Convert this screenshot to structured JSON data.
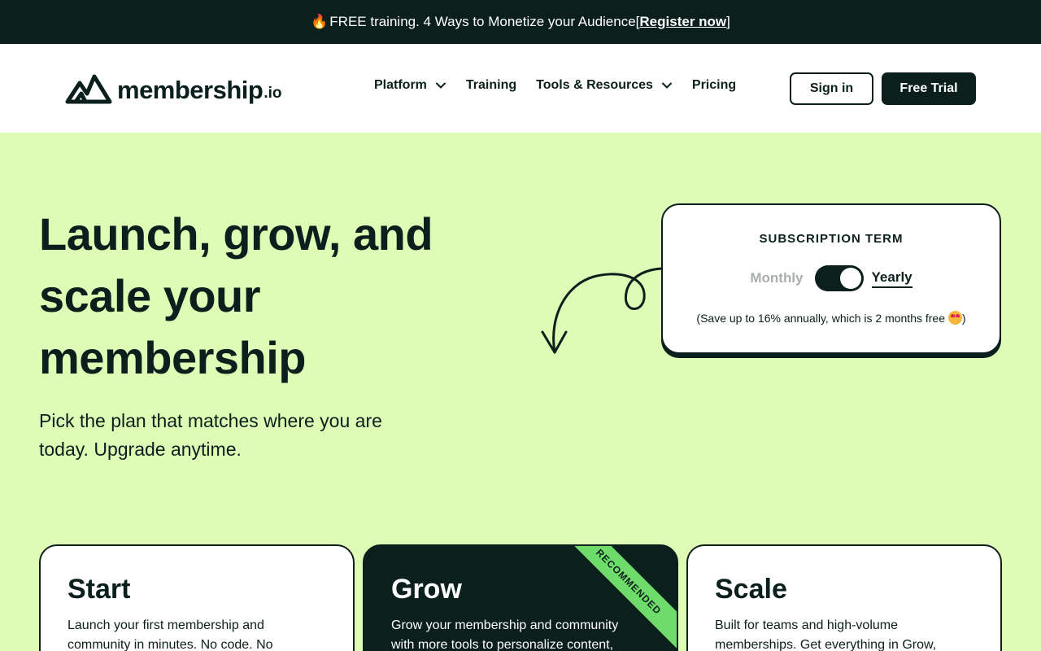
{
  "promo": {
    "flame_icon": "fire-emoji",
    "text": "FREE training. 4 Ways to Monetize your Audience ",
    "bracket_open": "[",
    "link": "Register now",
    "bracket_close": "]"
  },
  "nav": {
    "logo_word": "membership",
    "logo_tld": ".io",
    "links": [
      {
        "label": "Platform",
        "has_dropdown": true
      },
      {
        "label": "Training",
        "has_dropdown": false
      },
      {
        "label": "Tools & Resources",
        "has_dropdown": true
      },
      {
        "label": "Pricing",
        "has_dropdown": false
      }
    ],
    "signin_label": "Sign in",
    "trial_label": "Free Trial"
  },
  "hero": {
    "title": "Launch, grow, and scale your membership",
    "subtitle": "Pick the plan that matches where you are today. Upgrade anytime."
  },
  "term": {
    "title": "SUBSCRIPTION TERM",
    "monthly": "Monthly",
    "yearly": "Yearly",
    "selected": "Yearly",
    "note": "(Save up to 16% annually, which is 2 months free ",
    "note_close": ")",
    "note_icon": "heart-eyes-emoji"
  },
  "plans": [
    {
      "name": "Start",
      "desc": "Launch your first membership and community in minutes. No code. No"
    },
    {
      "name": "Grow",
      "desc": "Grow your membership and community with more tools to personalize content,",
      "badge": "RECOMMENDED"
    },
    {
      "name": "Scale",
      "desc": "Built for teams and high-volume memberships. Get everything in Grow,"
    }
  ],
  "colors": {
    "dark": "#0b1f1c",
    "hero_bg": "#dffbb5",
    "badge_green": "#6ddc6a"
  }
}
